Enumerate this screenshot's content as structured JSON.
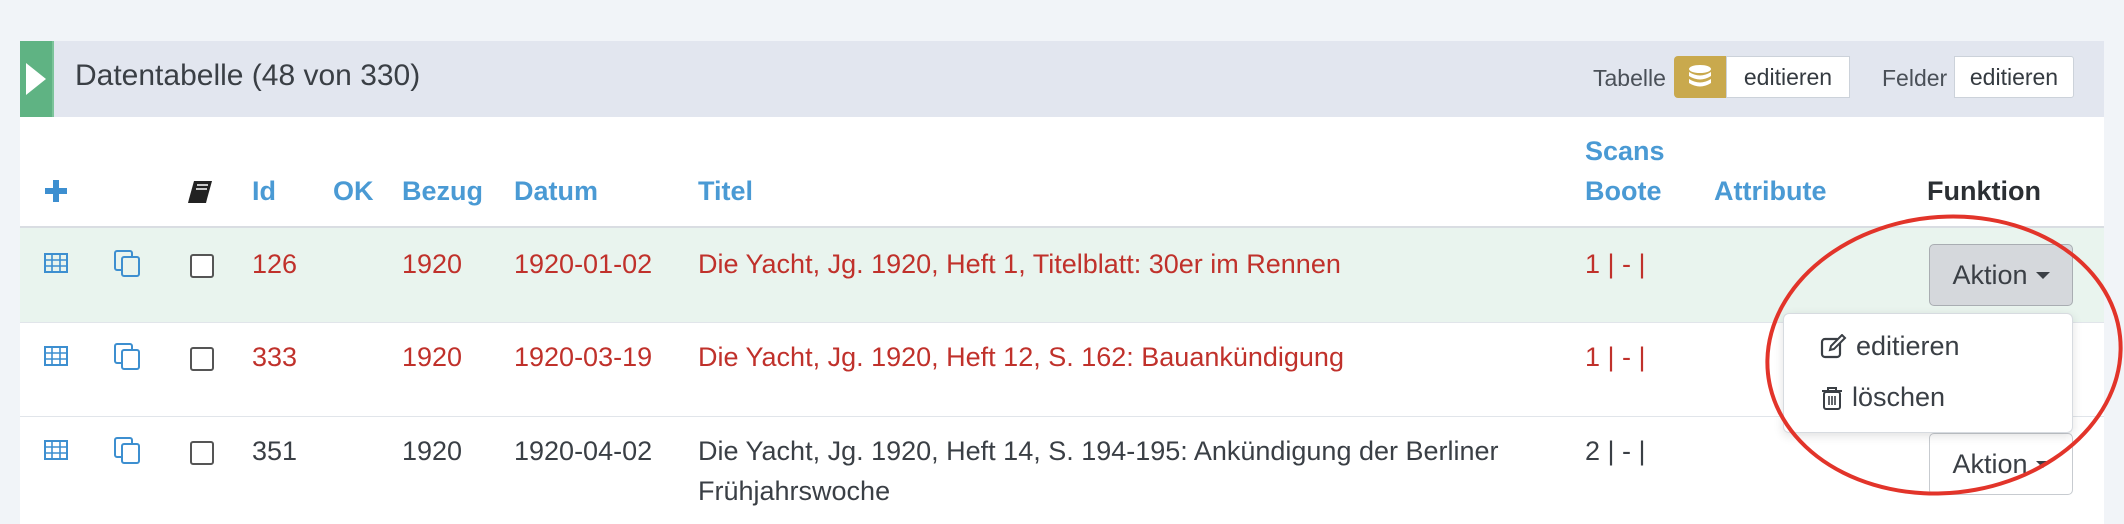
{
  "panel": {
    "title": "Datentabelle (48 von 330)",
    "tabelle_label": "Tabelle",
    "tabelle_edit": "editieren",
    "felder_label": "Felder",
    "felder_edit": "editieren"
  },
  "table": {
    "headers": {
      "id": "Id",
      "ok": "OK",
      "bezug": "Bezug",
      "datum": "Datum",
      "titel": "Titel",
      "scans": "Scans",
      "boote": "Boote",
      "attribute": "Attribute",
      "funktion": "Funktion"
    },
    "rows": [
      {
        "id": "126",
        "bezug": "1920",
        "datum": "1920-01-02",
        "titel": "Die Yacht, Jg. 1920, Heft 1, Titelblatt: 30er im Rennen",
        "scans": "1 | - |"
      },
      {
        "id": "333",
        "bezug": "1920",
        "datum": "1920-03-19",
        "titel": "Die Yacht, Jg. 1920, Heft 12, S. 162: Bauankündigung",
        "scans": "1 | - |"
      },
      {
        "id": "351",
        "bezug": "1920",
        "datum": "1920-04-02",
        "titel_line1": "Die Yacht, Jg. 1920, Heft 14, S. 194-195: Ankündigung der Berliner",
        "titel_line2": "Frühjahrswoche",
        "scans": "2 | - |"
      }
    ]
  },
  "actions": {
    "aktion_label": "Aktion",
    "menu": {
      "edit": "editieren",
      "delete": "löschen"
    }
  },
  "colors": {
    "accent_blue": "#4a9ad4",
    "highlight_red": "#c0312b",
    "toggle_green": "#5fb383",
    "db_gold": "#c9a94d",
    "annotation_red": "#e2342a"
  },
  "icons": [
    "play-icon",
    "database-icon",
    "plus-icon",
    "book-icon",
    "table-icon",
    "copy-icon",
    "caret-down-icon",
    "edit-icon",
    "trash-icon"
  ]
}
